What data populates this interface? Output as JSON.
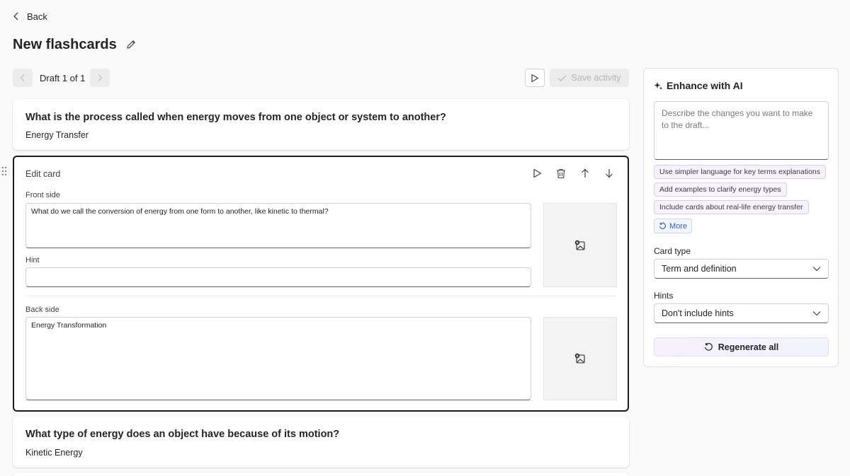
{
  "header": {
    "back_label": "Back",
    "title": "New flashcards"
  },
  "toolbar": {
    "draft_label": "Draft 1 of 1",
    "save_label": "Save activity"
  },
  "cards": [
    {
      "question": "What is the process called when energy moves from one object or system to another?",
      "answer": "Energy Transfer"
    },
    {
      "question": "What type of energy does an object have because of its motion?",
      "answer": "Kinetic Energy"
    }
  ],
  "edit_card": {
    "title": "Edit card",
    "front_label": "Front side",
    "front_value": "What do we call the conversion of energy from one form to another, like kinetic to thermal?",
    "hint_label": "Hint",
    "hint_value": "",
    "back_label": "Back side",
    "back_value": "Energy Transformation"
  },
  "panel": {
    "title": "Enhance with AI",
    "prompt_placeholder": "Describe the changes you want to make to the draft...",
    "suggestions": [
      "Use simpler language for key terms explanations",
      "Add examples to clarify energy types",
      "Include cards about real-life energy transfer"
    ],
    "more_label": "More",
    "card_type_label": "Card type",
    "card_type_value": "Term and definition",
    "hints_label": "Hints",
    "hints_value": "Don't include hints",
    "regenerate_label": "Regenerate all"
  },
  "colors": {
    "accent_purple": "#5b3fc4",
    "chip_border": "#d9cdf2",
    "more_blue": "#3a5cc7"
  }
}
